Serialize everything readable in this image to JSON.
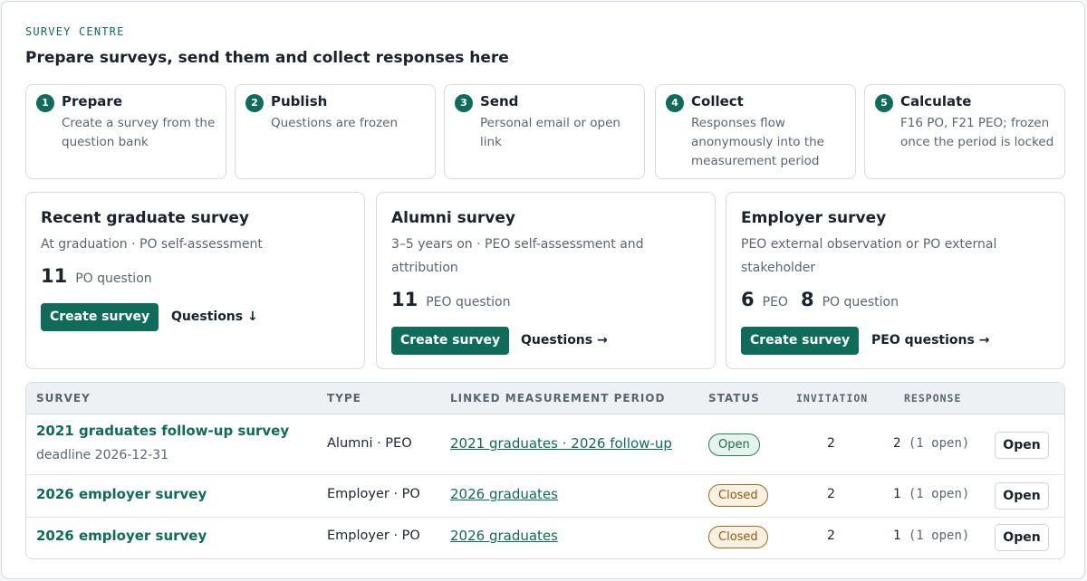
{
  "header": {
    "eyebrow": "SURVEY CENTRE",
    "title": "Prepare surveys, send them and collect responses here"
  },
  "steps": [
    {
      "num": "1",
      "title": "Prepare",
      "desc": "Create a survey from the question bank"
    },
    {
      "num": "2",
      "title": "Publish",
      "desc": "Questions are frozen"
    },
    {
      "num": "3",
      "title": "Send",
      "desc": "Personal email or open link"
    },
    {
      "num": "4",
      "title": "Collect",
      "desc": "Responses flow anonymously into the measurement period"
    },
    {
      "num": "5",
      "title": "Calculate",
      "desc": "F16 PO, F21 PEO; frozen once the period is locked"
    }
  ],
  "cards": [
    {
      "title": "Recent graduate survey",
      "desc": "At graduation · PO self-assessment",
      "counts": [
        {
          "num": "11",
          "label": "PO question"
        }
      ],
      "create_label": "Create survey",
      "link_label": "Questions ↓"
    },
    {
      "title": "Alumni survey",
      "desc": "3–5 years on · PEO self-assessment and attribution",
      "counts": [
        {
          "num": "11",
          "label": "PEO question"
        }
      ],
      "create_label": "Create survey",
      "link_label": "Questions →"
    },
    {
      "title": "Employer survey",
      "desc": "PEO external observation or PO external stakeholder",
      "counts": [
        {
          "num": "6",
          "label": "PEO"
        },
        {
          "num": "8",
          "label": "PO question"
        }
      ],
      "create_label": "Create survey",
      "link_label": "PEO questions →"
    }
  ],
  "table": {
    "headers": {
      "survey": "SURVEY",
      "type": "TYPE",
      "period": "LINKED MEASUREMENT PERIOD",
      "status": "STATUS",
      "invitation": "INVITATION",
      "response": "RESPONSE"
    },
    "rows": [
      {
        "name": "2021 graduates follow-up survey",
        "deadline": "deadline 2026-12-31",
        "type": "Alumni · PEO",
        "period": "2021 graduates · 2026 follow-up",
        "status": "Open",
        "invitation": "2",
        "response": "2",
        "response_sub": "(1 open)",
        "action": "Open"
      },
      {
        "name": "2026 employer survey",
        "deadline": "",
        "type": "Employer · PO",
        "period": "2026 graduates",
        "status": "Closed",
        "invitation": "2",
        "response": "1",
        "response_sub": "(1 open)",
        "action": "Open"
      },
      {
        "name": "2026 employer survey",
        "deadline": "",
        "type": "Employer · PO",
        "period": "2026 graduates",
        "status": "Closed",
        "invitation": "2",
        "response": "1",
        "response_sub": "(1 open)",
        "action": "Open"
      }
    ]
  },
  "colors": {
    "accent": "#0f6b5a",
    "open_badge": "#2e7d5e",
    "closed_badge": "#9a6b1e"
  }
}
